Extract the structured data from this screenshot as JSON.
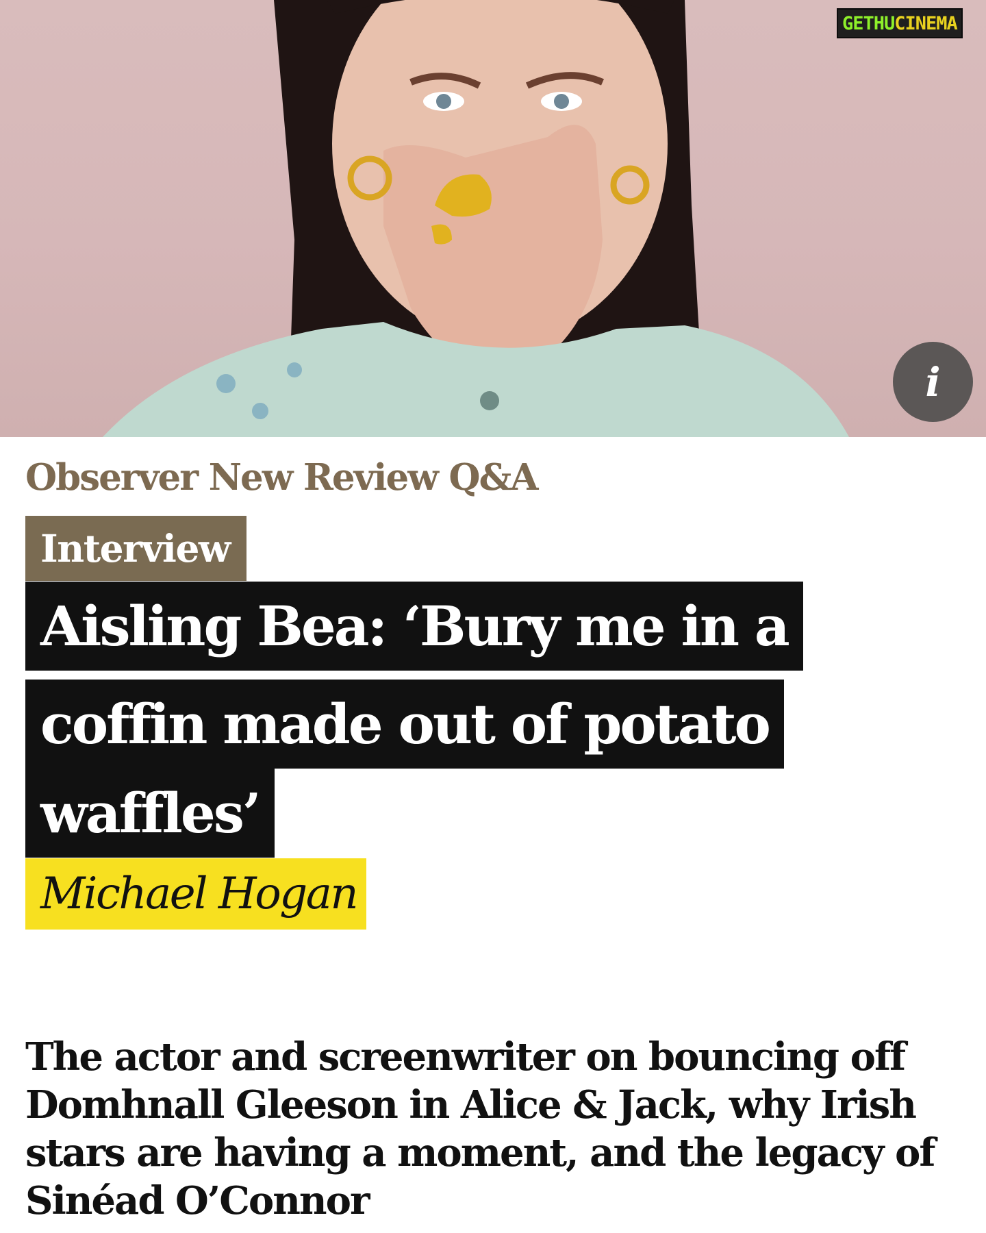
{
  "hero": {
    "image": "portrait-photo",
    "info_icon": "info-icon",
    "info_label": "i"
  },
  "watermark": {
    "part1": "GETHU",
    "part2": "CINEMA"
  },
  "article": {
    "series": "Observer New Review Q&A",
    "tag": "Interview",
    "headline_lines": [
      "Aisling Bea: ‘Bury me in a",
      "coffin made out of potato",
      "waffles’"
    ],
    "author": "Michael Hogan",
    "standfirst": "The actor and screenwriter on bouncing off Domhnall Gleeson in Alice & Jack, why Irish stars are having a moment, and the legacy of Sinéad O’Connor"
  },
  "colors": {
    "series": "#7d6a51",
    "tag_bg": "#7a6b52",
    "headline_bg": "#111111",
    "byline_bg": "#f7e020"
  }
}
